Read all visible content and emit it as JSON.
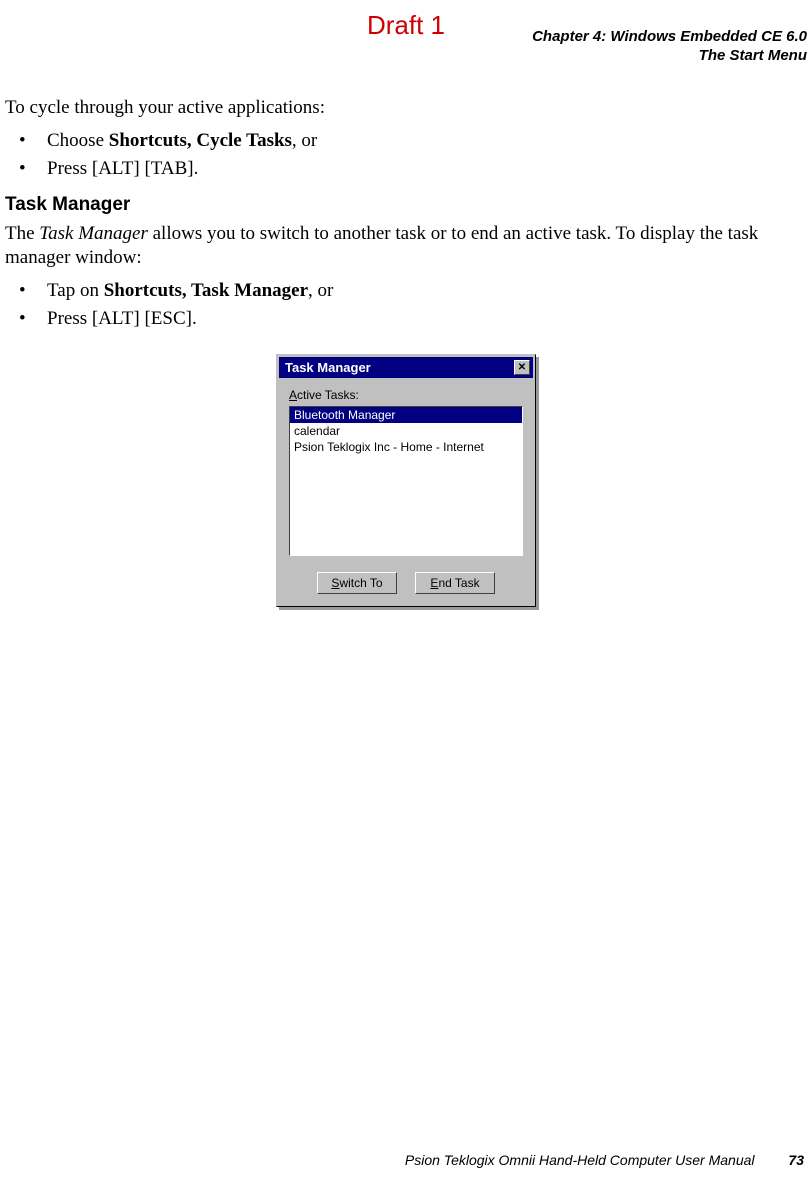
{
  "watermark": "Draft 1",
  "header": {
    "line1": "Chapter 4:  Windows Embedded CE 6.0",
    "line2": "The Start Menu"
  },
  "intro": "To cycle through your active applications:",
  "bullets1": {
    "b0_pre": "Choose ",
    "b0_bold": "Shortcuts, Cycle Tasks",
    "b0_post": ", or",
    "b1": "Press [ALT] [TAB]."
  },
  "section_heading": "Task Manager",
  "tm_para_pre": "The ",
  "tm_para_em": "Task Manager",
  "tm_para_post": " allows you to switch to another task or to end an active task. To display the task manager window:",
  "bullets2": {
    "b0_pre": "Tap on ",
    "b0_bold": "Shortcuts, Task Manager",
    "b0_post": ", or",
    "b1": "Press [ALT] [ESC]."
  },
  "window": {
    "title": "Task Manager",
    "active_label_u": "A",
    "active_label_rest": "ctive Tasks:",
    "items": [
      "Bluetooth Manager",
      "calendar",
      "Psion Teklogix Inc  - Home - Internet"
    ],
    "btn_switch_u": "S",
    "btn_switch_rest": "witch To",
    "btn_end_u": "E",
    "btn_end_rest": "nd Task"
  },
  "footer": {
    "text": "Psion Teklogix Omnii Hand-Held Computer User Manual",
    "page": "73"
  }
}
